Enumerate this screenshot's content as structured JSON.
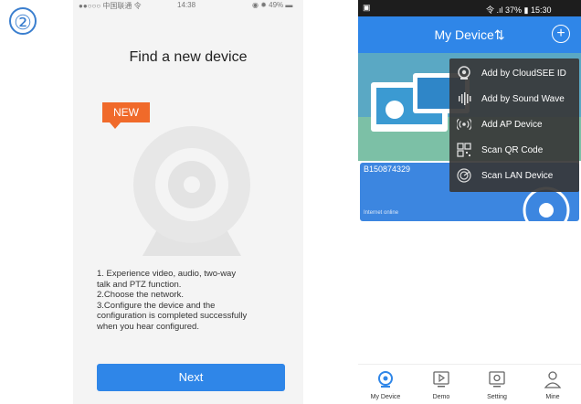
{
  "step_badge": "②",
  "left_phone": {
    "status_carrier": "●●○○○ 中国联通 令",
    "status_time": "14:38",
    "status_battery": "◉ ✹ 49% ▬",
    "title": "Find a new device",
    "new_badge": "NEW",
    "instructions": [
      "1. Experience  video, audio, two-way",
      "talk and PTZ function.",
      "2.Choose the network.",
      "3.Configure the device and the",
      "configuration is completed successfully",
      "when you hear configured."
    ],
    "next_button": "Next"
  },
  "right_phone": {
    "status_left": "▣",
    "status_right": "令 .ıl 37% ▮ 15:30",
    "header_title": "My Device",
    "header_arrows": "⇅",
    "add_symbol": "+",
    "device_id": "B150874329",
    "device_status": "Internet online",
    "menu": [
      {
        "label": "Add by CloudSEE ID",
        "icon": "cloudsee-icon"
      },
      {
        "label": "Add by Sound Wave",
        "icon": "sound-wave-icon"
      },
      {
        "label": "Add AP Device",
        "icon": "ap-signal-icon"
      },
      {
        "label": "Scan QR Code",
        "icon": "qr-code-icon"
      },
      {
        "label": "Scan LAN Device",
        "icon": "lan-scan-icon"
      }
    ],
    "tabs": [
      {
        "label": "My Device",
        "icon": "camera-icon",
        "active": true
      },
      {
        "label": "Demo",
        "icon": "play-icon",
        "active": false
      },
      {
        "label": "Setting",
        "icon": "gear-icon",
        "active": false
      },
      {
        "label": "Mine",
        "icon": "user-icon",
        "active": false
      }
    ]
  },
  "colors": {
    "accent_blue": "#2f86e8",
    "new_orange": "#f06a2a",
    "menu_dark": "#373737",
    "card_blue": "#3c86e0"
  }
}
